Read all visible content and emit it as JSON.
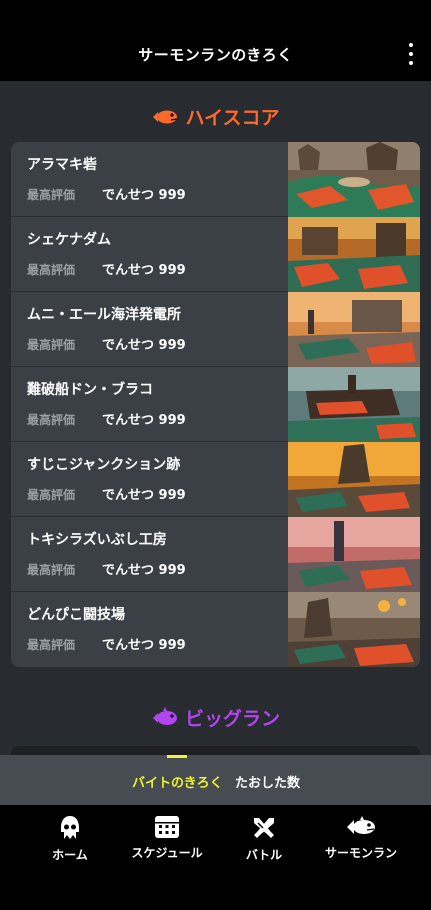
{
  "header": {
    "title": "サーモンランのきろく",
    "menu_icon": "more-vert-icon"
  },
  "highscore": {
    "title": "ハイスコア",
    "icon": "salmon-fish-icon",
    "accent": "#ff6a2b",
    "stages": [
      {
        "name": "アラマキ砦",
        "label": "最高評価",
        "value": "でんせつ 999"
      },
      {
        "name": "シェケナダム",
        "label": "最高評価",
        "value": "でんせつ 999"
      },
      {
        "name": "ムニ・エール海洋発電所",
        "label": "最高評価",
        "value": "でんせつ 999"
      },
      {
        "name": "難破船ドン・ブラコ",
        "label": "最高評価",
        "value": "でんせつ 999"
      },
      {
        "name": "すじこジャンクション跡",
        "label": "最高評価",
        "value": "でんせつ 999"
      },
      {
        "name": "トキシラズいぶし工房",
        "label": "最高評価",
        "value": "でんせつ 999"
      },
      {
        "name": "どんぴこ闘技場",
        "label": "最高評価",
        "value": "でんせつ 999"
      }
    ]
  },
  "bigrun": {
    "title": "ビッグラン",
    "icon": "bigrun-fish-icon",
    "accent": "#b145f0"
  },
  "subtabs": {
    "active": "バイトのきろく",
    "other": "たおした数",
    "active_color": "#ebf530"
  },
  "bottom_nav": [
    {
      "label": "ホーム",
      "icon": "squid-home-icon"
    },
    {
      "label": "スケジュール",
      "icon": "calendar-icon"
    },
    {
      "label": "バトル",
      "icon": "crossed-weapons-icon"
    },
    {
      "label": "サーモンラン",
      "icon": "salmon-icon"
    }
  ]
}
